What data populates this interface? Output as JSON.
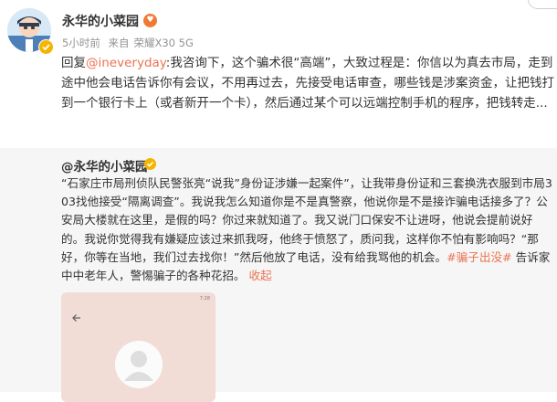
{
  "post": {
    "username": "永华的小菜园",
    "meta": {
      "time": "5小时前",
      "source_prefix": "来自",
      "source_device": "荣耀X30 5G"
    },
    "reply_prefix": "回复",
    "mention": "@ineveryday",
    "body": ":我咨询下，这个骗术很“高端”，大致过程是：你信以为真去市局，走到途中他会电话告诉你有会议，不用再过去，先接受电话审查，哪些钱是涉案资金，让把钱打到一个银行卡上（或者新开一个卡），然后通过某个可以远端控制手机的程序，把钱转走..."
  },
  "repost": {
    "author": "@永华的小菜园",
    "text_before_tag": "“石家庄市局刑侦队民警张亮“说我”身份证涉嫌一起案件”，让我带身份证和三套换洗衣服到市局303找他接受“隔离调查”。我说我怎么知道你是不是真警察，他说你是不是接诈骗电话接多了？公安局大楼就在这里，是假的吗？你过来就知道了。我又说门口保安不让进呀，他说会提前说好的。我说你觉得我有嫌疑应该过来抓我呀，他终于愤怒了，质问我，这样你不怕有影响吗？“那好，你等在当地，我们过去找你！”然后他放了电话，没有给我骂他的机会。",
    "hashtag": "#骗子出没#",
    "text_after_tag": " 告诉家中中老年人，警惕骗子的各种花招。",
    "collapse_label": "收起",
    "thumbnail": {
      "status_time": "7:28"
    }
  },
  "colors": {
    "link": "#eb7350",
    "verified": "#f5b400",
    "repost_bg": "#f6f6f6"
  }
}
